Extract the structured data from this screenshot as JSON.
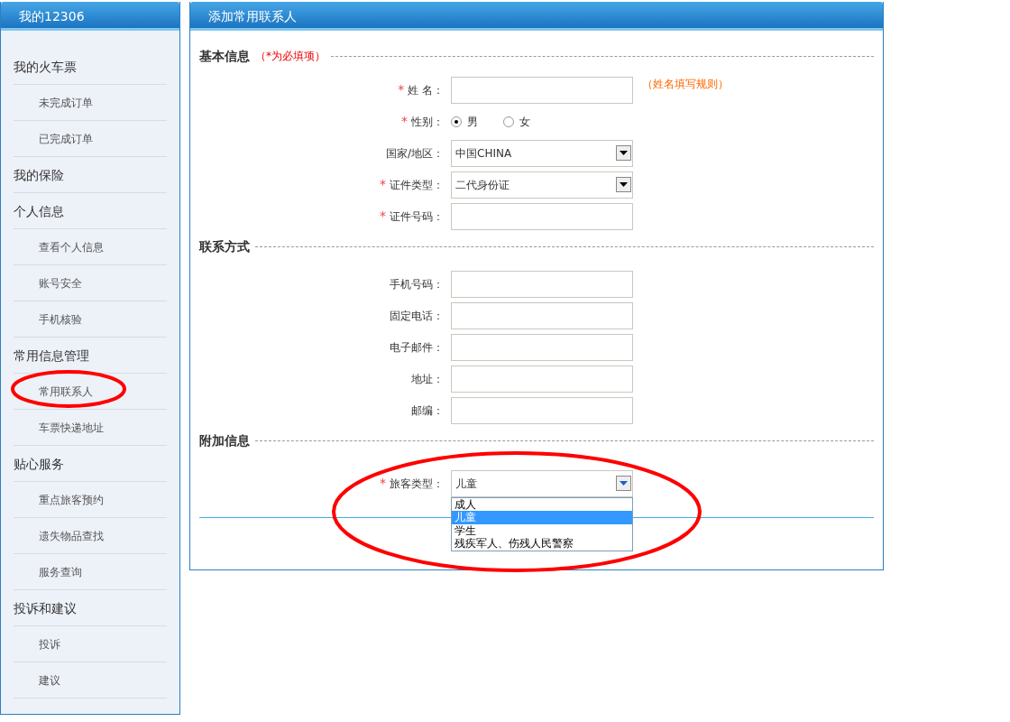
{
  "sidebar": {
    "title": "我的12306",
    "groups": [
      {
        "label": "我的火车票",
        "children": [
          {
            "label": "未完成订单"
          },
          {
            "label": "已完成订单"
          }
        ]
      },
      {
        "label": "我的保险"
      },
      {
        "label": "个人信息",
        "children": [
          {
            "label": "查看个人信息"
          },
          {
            "label": "账号安全"
          },
          {
            "label": "手机核验"
          }
        ]
      },
      {
        "label": "常用信息管理",
        "children": [
          {
            "label": "常用联系人"
          },
          {
            "label": "车票快递地址"
          }
        ]
      },
      {
        "label": "贴心服务",
        "children": [
          {
            "label": "重点旅客预约"
          },
          {
            "label": "遗失物品查找"
          },
          {
            "label": "服务查询"
          }
        ]
      },
      {
        "label": "投诉和建议",
        "children": [
          {
            "label": "投诉"
          },
          {
            "label": "建议"
          }
        ]
      }
    ]
  },
  "panel": {
    "title": "添加常用联系人",
    "sections": [
      {
        "title": "基本信息",
        "note": "（*为必填项）",
        "fields": [
          {
            "kind": "text",
            "mark": "*",
            "label": "姓 名：",
            "hint": "（姓名填写规则）"
          },
          {
            "kind": "radio",
            "mark": "*",
            "label": "性别：",
            "options": [
              {
                "label": "男",
                "selected": true
              },
              {
                "label": "女",
                "selected": false
              }
            ]
          },
          {
            "kind": "select",
            "label": "国家/地区：",
            "value": "中国CHINA"
          },
          {
            "kind": "select",
            "mark": "*",
            "label": "证件类型：",
            "value": "二代身份证"
          },
          {
            "kind": "text",
            "mark": "*",
            "label": "证件号码："
          }
        ]
      },
      {
        "title": "联系方式",
        "fields": [
          {
            "kind": "text",
            "label": "手机号码："
          },
          {
            "kind": "text",
            "label": "固定电话："
          },
          {
            "kind": "text",
            "label": "电子邮件："
          },
          {
            "kind": "text",
            "label": "地址："
          },
          {
            "kind": "text",
            "label": "邮编："
          }
        ]
      },
      {
        "title": "附加信息",
        "fields": [
          {
            "kind": "select",
            "mark": "*",
            "label": "旅客类型：",
            "value": "儿童",
            "expanded": true,
            "options": [
              {
                "label": "成人",
                "selected": false
              },
              {
                "label": "儿童",
                "selected": true
              },
              {
                "label": "学生",
                "selected": false
              },
              {
                "label": "残疾军人、伤残人民警察",
                "selected": false
              }
            ]
          }
        ]
      }
    ]
  }
}
